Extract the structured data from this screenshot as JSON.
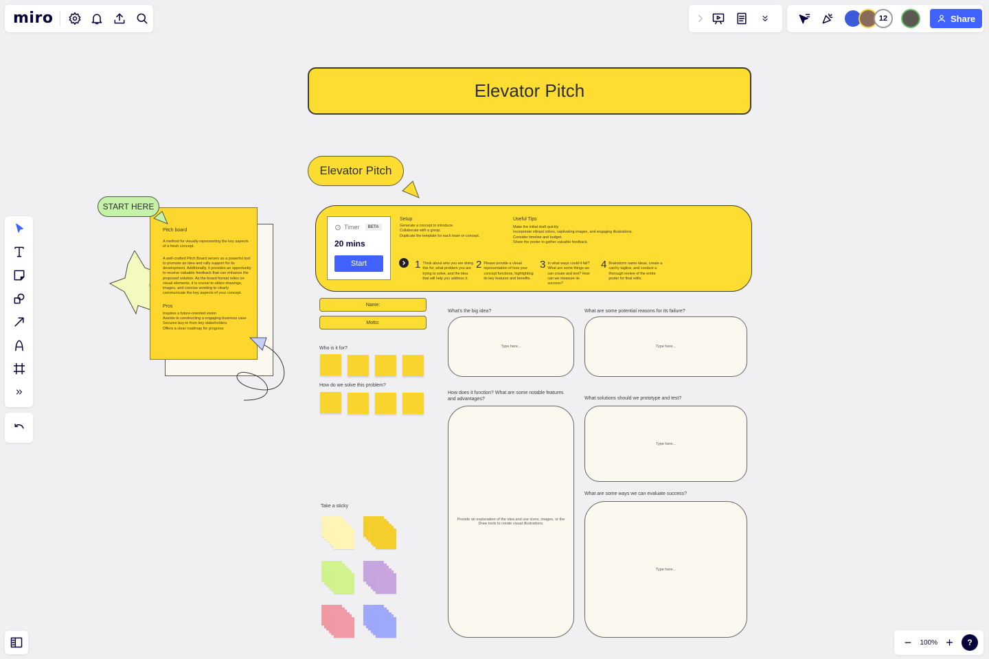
{
  "app": {
    "logo": "miro"
  },
  "toolbar_left": {
    "icons": [
      "settings-icon",
      "bell-icon",
      "upload-icon",
      "search-icon"
    ]
  },
  "toolbar_mid": {
    "icons": [
      "chevron-right-icon",
      "presentation-icon",
      "notes-icon",
      "chevrons-down-icon"
    ]
  },
  "toolbar_right": {
    "icons": [
      "reactions-cursor-icon",
      "celebrate-icon"
    ],
    "collaborator_count": "12",
    "share_label": "Share"
  },
  "left_tools": [
    "select-tool",
    "text-tool",
    "sticky-note-tool",
    "shapes-tool",
    "connector-tool",
    "pen-tool",
    "frame-tool",
    "more-tools"
  ],
  "zoom": {
    "level": "100%",
    "minus": "−",
    "plus": "+",
    "help": "?"
  },
  "board": {
    "title": "Elevator Pitch",
    "pill_title": "Elevator Pitch",
    "start_here": "START HERE",
    "pitch_card": {
      "heading": "Pitch board",
      "intro": "A method for visually representing the key aspects of a fresh concept.",
      "body": "A well-crafted Pitch Board serves as a powerful tool to promote an idea and rally support for its development. Additionally, it provides an opportunity to receive valuable feedback that can enhance the proposed solution. As the board format relies on visual elements, it is crucial to utilize drawings, images, and concise wording to clearly communicate the key aspects of your concept.",
      "pros_heading": "Pros",
      "pros": [
        "Inspires a future-oriented vision",
        "Assists in constructing a engaging business case",
        "Secures buy-in from key stakeholders",
        "Offers a clear roadmap for progress"
      ]
    },
    "timer": {
      "label": "Timer",
      "badge": "BETA",
      "duration": "20 mins",
      "start": "Start"
    },
    "setup": {
      "heading": "Setup",
      "lines": [
        "Generate a concept to introduce.",
        "Collaborate with a group.",
        "Duplicate the template for each team or concept."
      ]
    },
    "tips": {
      "heading": "Useful Tips",
      "lines": [
        "Make the initial draft quickly",
        "Incorporate vibrant colors, captivating images, and engaging illustrations.",
        "Consider timeline and budget.",
        "Share the poster to gather valuable feedback."
      ]
    },
    "steps": [
      {
        "num": "1",
        "text": "Think about who you are doing this for, what problem you are trying to solve, and the idea that will help you address it."
      },
      {
        "num": "2",
        "text": "Please provide a visual representation of how your concept functions, highlighting its key features and benefits."
      },
      {
        "num": "3",
        "text": "In what ways could it fail? What are some things we can create and test? How can we measure its success?"
      },
      {
        "num": "4",
        "text": "Brainstorm name ideas, create a catchy tagline, and conduct a thorough review of the entire poster for final edits."
      }
    ],
    "fields": {
      "name": "Name:",
      "motto": "Motto:"
    },
    "who_label": "Who is it for?",
    "how_label": "How do we solve this problem?",
    "take_sticky": "Take a sticky",
    "sticky_colors": [
      "#fff6b6",
      "#f5cf2c",
      "#d1f28c",
      "#c7a6e0",
      "#ef9aa5",
      "#9ea9fa"
    ],
    "questions": {
      "big_idea": {
        "label": "What's the big idea?",
        "placeholder": "Type here..."
      },
      "failure": {
        "label": "What are some potential reasons for its failure?",
        "placeholder": "Type here..."
      },
      "function": {
        "label": "How does it function? What are some notable features and advantages?",
        "placeholder": "Provide an explanation of the idea and use icons, images, or the Draw tools to create visual illustrations."
      },
      "prototype": {
        "label": "What solutions should we prototype and test?",
        "placeholder": "Type here..."
      },
      "evaluate": {
        "label": "What are some ways we can evaluate success?",
        "placeholder": "Type here..."
      }
    }
  },
  "colors": {
    "accent": "#4262ff",
    "yellow": "#fedd33",
    "canvas": "#f0f0f3",
    "card": "#faf8ef",
    "green_pill": "#c5f2a8"
  }
}
